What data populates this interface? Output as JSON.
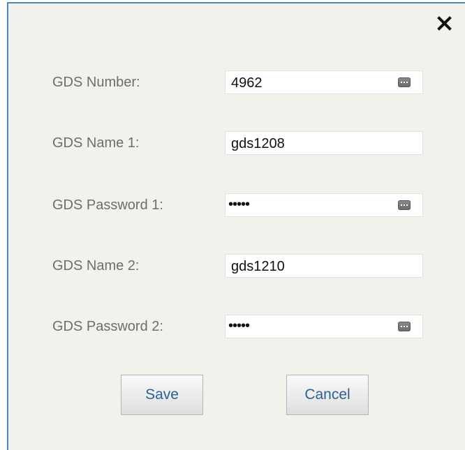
{
  "dialog": {
    "close_icon": "close-icon",
    "fields": [
      {
        "label": "GDS Number:",
        "value": "4962",
        "type": "text",
        "icon": "keypad-icon"
      },
      {
        "label": "GDS Name 1:",
        "value": "gds1208",
        "type": "text",
        "icon": ""
      },
      {
        "label": "GDS Password 1:",
        "value": "•••••",
        "type": "password",
        "icon": "keypad-icon"
      },
      {
        "label": "GDS Name 2:",
        "value": "gds1210",
        "type": "text",
        "icon": ""
      },
      {
        "label": "GDS Password 2:",
        "value": "•••••",
        "type": "password",
        "icon": "keypad-icon"
      }
    ],
    "save_label": "Save",
    "cancel_label": "Cancel"
  },
  "colors": {
    "dialog_background": "#f2f2ed",
    "dialog_border": "#4d84c4",
    "button_text": "#2c5f97",
    "label_text": "#6d6d6d"
  }
}
